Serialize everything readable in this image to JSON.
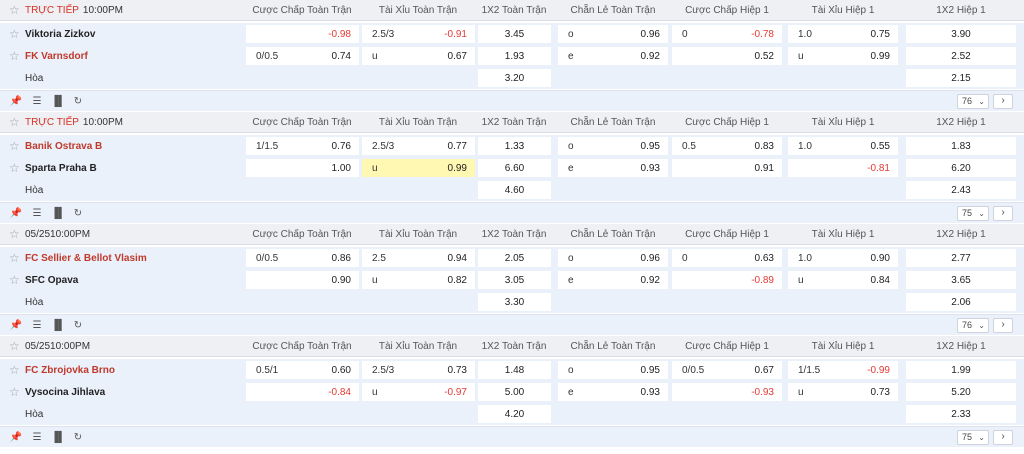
{
  "columns": [
    "Cược Chấp Toàn Trận",
    "Tài Xỉu Toàn Trận",
    "1X2 Toàn Trận",
    "Chẵn Lẻ Toàn Trận",
    "Cược Chấp Hiệp 1",
    "Tài Xỉu Hiệp 1",
    "1X2 Hiệp 1"
  ],
  "draw_label": "Hòa",
  "icons": {
    "star": "star-icon",
    "pin": "pin-icon",
    "list": "list-icon",
    "stats": "bar-chart-icon",
    "refresh": "refresh-icon",
    "next": "chevron-right-icon",
    "dropdown": "chevron-down-icon"
  },
  "colors": {
    "negative_odds": "#e53935",
    "live": "#d93025",
    "team_highlight": "#c0392b",
    "row_bg": "#eaf1fb",
    "highlight_cell": "#fff8b3"
  },
  "matches": [
    {
      "status": "TRỰC TIẾP",
      "time": "10:00PM",
      "markets_count": "76",
      "rows": [
        {
          "team": "Viktoria Zizkov",
          "team_red": false,
          "hc": {
            "h": "",
            "o": "-0.98"
          },
          "ou": {
            "h": "2.5/3",
            "o": "-0.91"
          },
          "x12": "3.45",
          "oe": {
            "h": "o",
            "o": "0.96"
          },
          "hc1": {
            "h": "0",
            "o": "-0.78"
          },
          "ou1": {
            "h": "1.0",
            "o": "0.75"
          },
          "x121": "3.90"
        },
        {
          "team": "FK Varnsdorf",
          "team_red": true,
          "hc": {
            "h": "0/0.5",
            "o": "0.74"
          },
          "ou": {
            "h": "u",
            "o": "0.67"
          },
          "x12": "1.93",
          "oe": {
            "h": "e",
            "o": "0.92"
          },
          "hc1": {
            "h": "",
            "o": "0.52"
          },
          "ou1": {
            "h": "u",
            "o": "0.99"
          },
          "x121": "2.52"
        }
      ],
      "draw": {
        "x12": "3.20",
        "x121": "2.15"
      }
    },
    {
      "status": "TRỰC TIẾP",
      "time": "10:00PM",
      "markets_count": "75",
      "rows": [
        {
          "team": "Banik Ostrava B",
          "team_red": true,
          "hc": {
            "h": "1/1.5",
            "o": "0.76"
          },
          "ou": {
            "h": "2.5/3",
            "o": "0.77"
          },
          "x12": "1.33",
          "oe": {
            "h": "o",
            "o": "0.95"
          },
          "hc1": {
            "h": "0.5",
            "o": "0.83"
          },
          "ou1": {
            "h": "1.0",
            "o": "0.55"
          },
          "x121": "1.83"
        },
        {
          "team": "Sparta Praha B",
          "team_red": false,
          "hc": {
            "h": "",
            "o": "1.00"
          },
          "ou": {
            "h": "u",
            "o": "0.99"
          },
          "x12": "6.60",
          "oe": {
            "h": "e",
            "o": "0.93"
          },
          "hc1": {
            "h": "",
            "o": "0.91"
          },
          "ou1": {
            "h": "",
            "o": "-0.81"
          },
          "x121": "6.20"
        }
      ],
      "draw": {
        "x12": "4.60",
        "x121": "2.43"
      }
    },
    {
      "status": "05/25",
      "time": "10:00PM",
      "markets_count": "76",
      "rows": [
        {
          "team": "FC Sellier & Bellot Vlasim",
          "team_red": true,
          "hc": {
            "h": "0/0.5",
            "o": "0.86"
          },
          "ou": {
            "h": "2.5",
            "o": "0.94"
          },
          "x12": "2.05",
          "oe": {
            "h": "o",
            "o": "0.96"
          },
          "hc1": {
            "h": "0",
            "o": "0.63"
          },
          "ou1": {
            "h": "1.0",
            "o": "0.90"
          },
          "x121": "2.77"
        },
        {
          "team": "SFC Opava",
          "team_red": false,
          "hc": {
            "h": "",
            "o": "0.90"
          },
          "ou": {
            "h": "u",
            "o": "0.82"
          },
          "x12": "3.05",
          "oe": {
            "h": "e",
            "o": "0.92"
          },
          "hc1": {
            "h": "",
            "o": "-0.89"
          },
          "ou1": {
            "h": "u",
            "o": "0.84"
          },
          "x121": "3.65"
        }
      ],
      "draw": {
        "x12": "3.30",
        "x121": "2.06"
      }
    },
    {
      "status": "05/25",
      "time": "10:00PM",
      "markets_count": "75",
      "rows": [
        {
          "team": "FC Zbrojovka Brno",
          "team_red": true,
          "hc": {
            "h": "0.5/1",
            "o": "0.60"
          },
          "ou": {
            "h": "2.5/3",
            "o": "0.73"
          },
          "x12": "1.48",
          "oe": {
            "h": "o",
            "o": "0.95"
          },
          "hc1": {
            "h": "0/0.5",
            "o": "0.67"
          },
          "ou1": {
            "h": "1/1.5",
            "o": "-0.99"
          },
          "x121": "1.99"
        },
        {
          "team": "Vysocina Jihlava",
          "team_red": false,
          "hc": {
            "h": "",
            "o": "-0.84"
          },
          "ou": {
            "h": "u",
            "o": "-0.97"
          },
          "x12": "5.00",
          "oe": {
            "h": "e",
            "o": "0.93"
          },
          "hc1": {
            "h": "",
            "o": "-0.93"
          },
          "ou1": {
            "h": "u",
            "o": "0.73"
          },
          "x121": "5.20"
        }
      ],
      "draw": {
        "x12": "4.20",
        "x121": "2.33"
      }
    }
  ]
}
